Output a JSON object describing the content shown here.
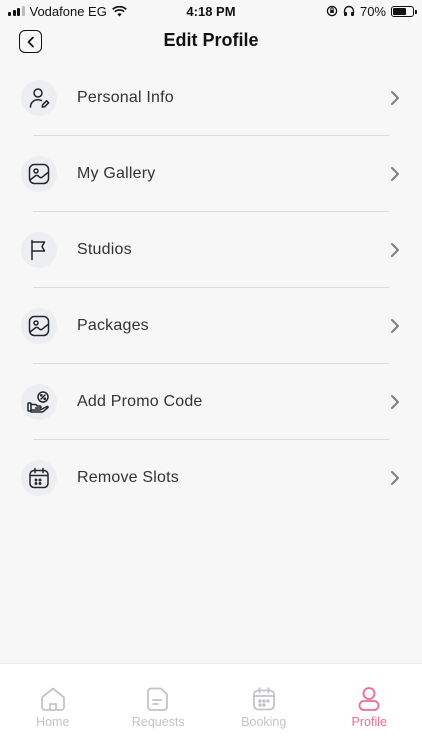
{
  "status_bar": {
    "carrier": "Vodafone EG",
    "time": "4:18 PM",
    "battery": "70%",
    "battery_level": 0.7
  },
  "header": {
    "title": "Edit Profile",
    "back_icon": "chevron-left-icon"
  },
  "menu": {
    "items": [
      {
        "label": "Personal Info",
        "icon": "user-edit-icon"
      },
      {
        "label": "My Gallery",
        "icon": "image-icon"
      },
      {
        "label": "Studios",
        "icon": "flag-icon"
      },
      {
        "label": "Packages",
        "icon": "image-icon"
      },
      {
        "label": "Add Promo Code",
        "icon": "promo-hand-icon"
      },
      {
        "label": "Remove Slots",
        "icon": "calendar-icon"
      }
    ]
  },
  "tabs": [
    {
      "label": "Home",
      "icon": "home-icon",
      "active": false
    },
    {
      "label": "Requests",
      "icon": "document-icon",
      "active": false
    },
    {
      "label": "Booking",
      "icon": "calendar-icon",
      "active": false
    },
    {
      "label": "Profile",
      "icon": "profile-icon",
      "active": true
    }
  ],
  "colors": {
    "accent": "#f06a8e",
    "inactive": "#c4c4c8",
    "background": "#f7f7f8"
  }
}
